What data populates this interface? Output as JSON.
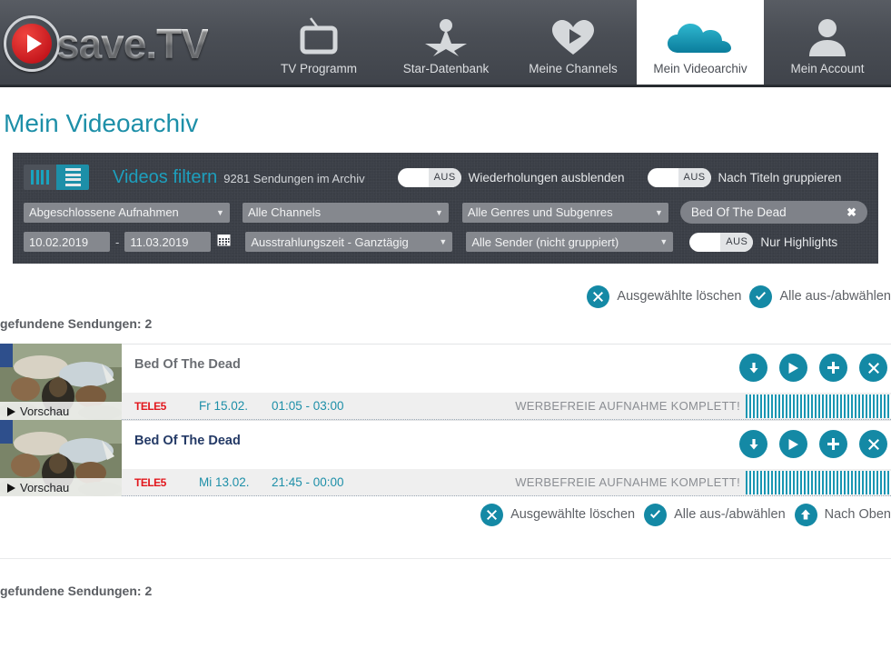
{
  "nav": {
    "logo_text": "save.TV",
    "items": [
      {
        "label": "TV Programm",
        "icon": "tv-icon",
        "active": false
      },
      {
        "label": "Star-Datenbank",
        "icon": "star-person-icon",
        "active": false
      },
      {
        "label": "Meine Channels",
        "icon": "heart-play-icon",
        "active": false
      },
      {
        "label": "Mein Videoarchiv",
        "icon": "cloud-icon",
        "active": true
      },
      {
        "label": "Mein Account",
        "icon": "person-icon",
        "active": false
      }
    ]
  },
  "page": {
    "title": "Mein Videoarchiv"
  },
  "filters": {
    "view_grid_icon": "grid-view-icon",
    "view_list_icon": "list-view-icon",
    "heading": "Videos filtern",
    "archive_count": "9281 Sendungen im Archiv",
    "toggles": [
      {
        "state": "AUS",
        "label": "Wiederholungen ausblenden"
      },
      {
        "state": "AUS",
        "label": "Nach Titeln gruppieren"
      },
      {
        "state": "AUS",
        "label": "Nur Highlights"
      }
    ],
    "selects": {
      "recordings": "Abgeschlossene Aufnahmen",
      "channels": "Alle Channels",
      "genres": "Alle Genres und Subgenres",
      "airtime": "Ausstrahlungszeit - Ganztägig",
      "senders": "Alle Sender (nicht gruppiert)"
    },
    "date_from": "10.02.2019",
    "date_sep": "-",
    "date_to": "11.03.2019",
    "calendar_icon": "calendar-icon",
    "search_chip": {
      "text": "Bed Of The Dead",
      "clear_icon": "close-icon"
    }
  },
  "actions_top": [
    {
      "icon": "delete-circle-icon",
      "label": "Ausgewählte löschen"
    },
    {
      "icon": "check-circle-icon",
      "label": "Alle aus-/abwählen"
    }
  ],
  "actions_bottom": [
    {
      "icon": "delete-circle-icon",
      "label": "Ausgewählte löschen"
    },
    {
      "icon": "check-circle-icon",
      "label": "Alle aus-/abwählen"
    },
    {
      "icon": "arrow-up-circle-icon",
      "label": "Nach Oben"
    }
  ],
  "results": {
    "found_label_top": "gefundene Sendungen: 2",
    "found_label_bottom": "gefundene Sendungen: 2",
    "preview_label": "Vorschau",
    "row_actions": [
      {
        "icon": "download-icon"
      },
      {
        "icon": "play-icon"
      },
      {
        "icon": "plus-icon"
      },
      {
        "icon": "close-icon"
      }
    ],
    "items": [
      {
        "title": "Bed Of The Dead",
        "selected": false,
        "channel": "TELE5",
        "day": "Fr 15.02.",
        "time": "01:05 - 03:00",
        "note": "WERBEFREIE AUFNAHME KOMPLETT!"
      },
      {
        "title": "Bed Of The Dead",
        "selected": true,
        "channel": "TELE5",
        "day": "Mi 13.02.",
        "time": "21:45 - 00:00",
        "note": "WERBEFREIE AUFNAHME KOMPLETT!"
      }
    ]
  },
  "colors": {
    "accent": "#1489a5",
    "accent_text": "#1d8fa8",
    "panel_bg": "#3b3f47",
    "nav_bg": "#4a4e55",
    "brand_red": "#c4161c",
    "channel_red": "#e2171d"
  }
}
